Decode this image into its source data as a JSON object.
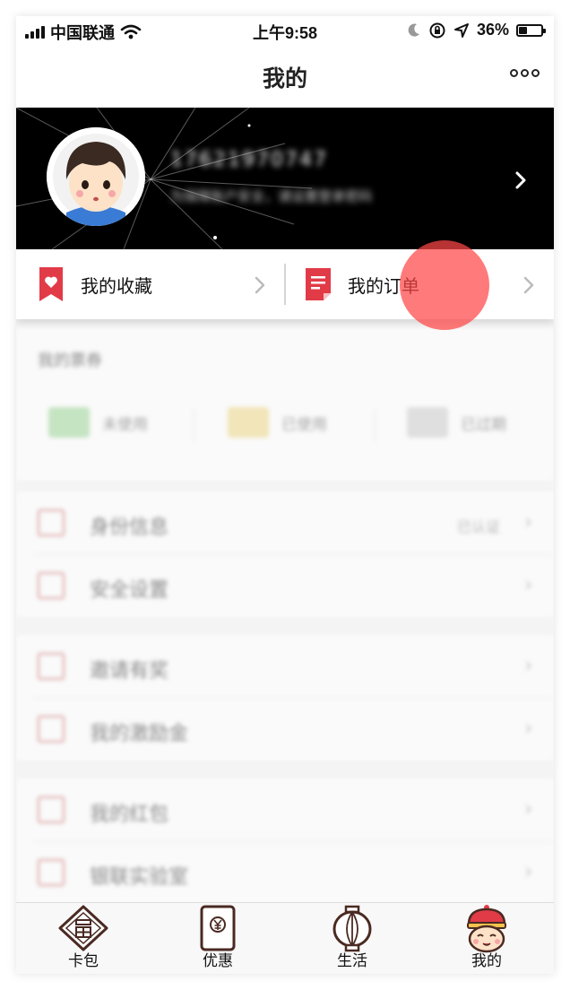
{
  "status_bar": {
    "carrier": "中国联通",
    "time": "上午9:58",
    "battery": "36%",
    "battery_level": 0.36,
    "icons": [
      "signal-icon",
      "wifi-icon",
      "moon-icon",
      "orientation-lock-icon",
      "location-icon",
      "battery-icon"
    ]
  },
  "nav": {
    "title": "我的",
    "more_icon": "more-dots-icon"
  },
  "profile": {
    "phone_number": "17621970747",
    "tip": "为保障账户安全，请设置登录密码",
    "avatar_icon": "boy-avatar-icon"
  },
  "quick_links": [
    {
      "label": "我的收藏",
      "icon": "bookmark-heart-icon"
    },
    {
      "label": "我的订单",
      "icon": "order-document-icon"
    }
  ],
  "coupons": {
    "title": "我的票券",
    "items": [
      {
        "label": "未使用",
        "color": "#9fd89a"
      },
      {
        "label": "已使用",
        "color": "#f0d98a"
      },
      {
        "label": "已过期",
        "color": "#cfcfcf"
      }
    ]
  },
  "groups": [
    [
      {
        "label": "身份信息",
        "value": "已认证"
      },
      {
        "label": "安全设置",
        "value": ""
      }
    ],
    [
      {
        "label": "邀请有奖",
        "value": ""
      },
      {
        "label": "我的激励金",
        "value": ""
      }
    ],
    [
      {
        "label": "我的红包",
        "value": ""
      },
      {
        "label": "银联实验室",
        "value": ""
      }
    ]
  ],
  "tabs": [
    {
      "label": "卡包",
      "icon": "fu-card-icon"
    },
    {
      "label": "优惠",
      "icon": "red-envelope-icon"
    },
    {
      "label": "生活",
      "icon": "lantern-icon"
    },
    {
      "label": "我的",
      "icon": "child-face-icon"
    }
  ],
  "colors": {
    "accent": "#e23b48",
    "banner_bg": "#000000",
    "touch_indicator": "#ff4646"
  }
}
